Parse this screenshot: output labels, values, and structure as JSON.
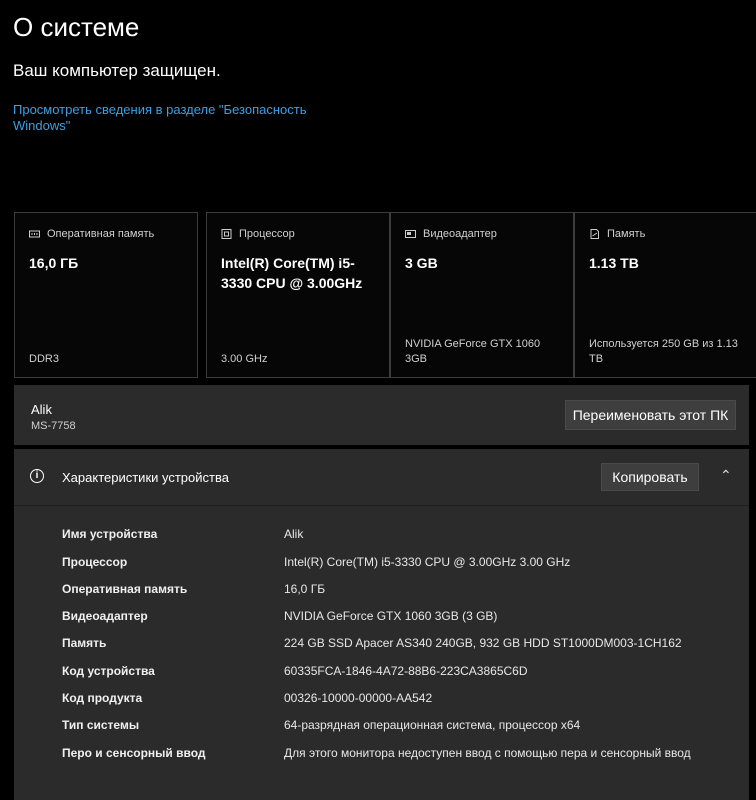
{
  "header": {
    "title": "О системе",
    "status": "Ваш компьютер защищен.",
    "security_link": "Просмотреть сведения в разделе \"Безопасность Windows\""
  },
  "cards": [
    {
      "icon": "memory-icon",
      "label": "Оперативная память",
      "value": "16,0 ГБ",
      "sub": "DDR3"
    },
    {
      "icon": "processor-icon",
      "label": "Процессор",
      "value": "Intel(R) Core(TM) i5-3330 CPU @ 3.00GHz",
      "sub": "3.00 GHz"
    },
    {
      "icon": "graphics-card-icon",
      "label": "Видеоадаптер",
      "value": "3 GB",
      "sub": "NVIDIA GeForce GTX 1060 3GB"
    },
    {
      "icon": "storage-icon",
      "label": "Память",
      "value": "1.13 TB",
      "sub": "Используется 250 GB из 1.13 TB"
    }
  ],
  "pc": {
    "name": "Alik",
    "model": "MS-7758",
    "rename_label": "Переименовать этот ПК"
  },
  "specs": {
    "title": "Характеристики устройства",
    "copy_label": "Копировать",
    "rows": [
      {
        "key": "Имя устройства",
        "value": "Alik"
      },
      {
        "key": "Процессор",
        "value": "Intel(R) Core(TM) i5-3330 CPU @ 3.00GHz   3.00 GHz"
      },
      {
        "key": "Оперативная память",
        "value": "16,0 ГБ"
      },
      {
        "key": "Видеоадаптер",
        "value": "NVIDIA GeForce GTX 1060 3GB (3 GB)"
      },
      {
        "key": "Память",
        "value": "224 GB SSD Apacer AS340 240GB, 932 GB HDD ST1000DM003-1CH162"
      },
      {
        "key": "Код устройства",
        "value": "60335FCA-1846-4A72-88B6-223CA3865C6D"
      },
      {
        "key": "Код продукта",
        "value": "00326-10000-00000-AA542"
      },
      {
        "key": "Тип системы",
        "value": "64-разрядная операционная система, процессор x64"
      },
      {
        "key": "Перо и сенсорный ввод",
        "value": "Для этого монитора недоступен ввод с помощью пера и сенсорный ввод"
      }
    ]
  },
  "colors": {
    "background": "#000000",
    "panel": "#2b2b2b",
    "link": "#3aa0e6"
  }
}
